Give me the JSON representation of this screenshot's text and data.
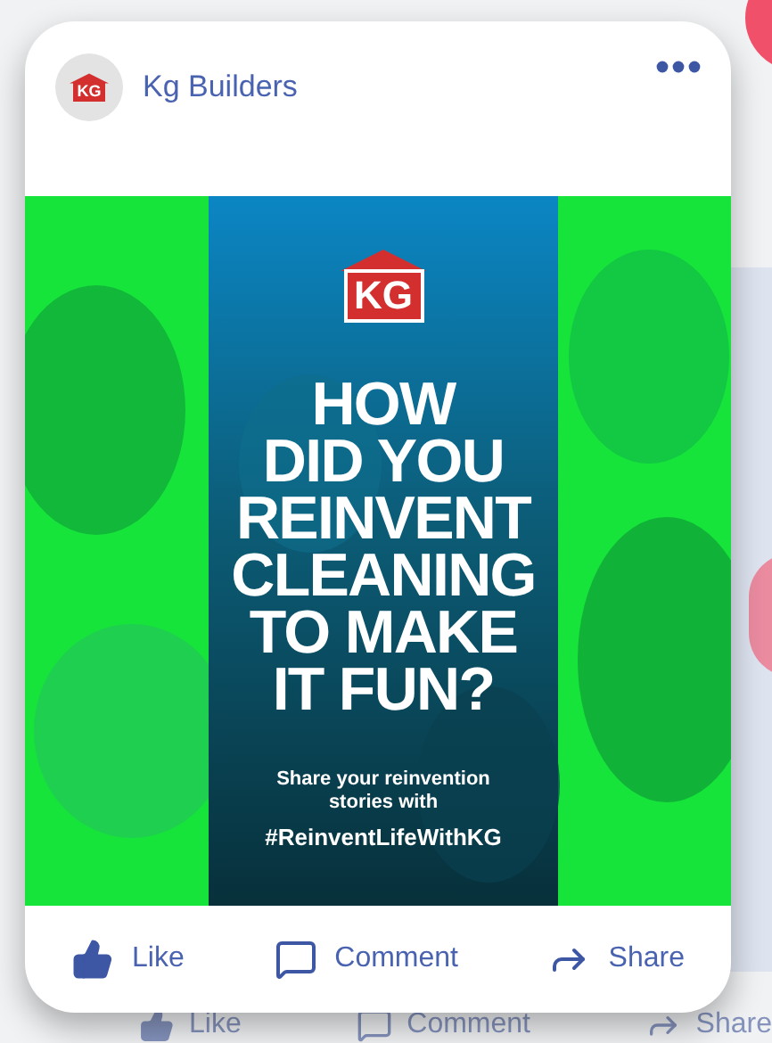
{
  "post": {
    "author": "Kg Builders",
    "avatar_logo": "KG",
    "image": {
      "logo": "KG",
      "headline": "HOW\nDID YOU\nREINVENT\nCLEANING\nTO MAKE\nIT FUN?",
      "caption": "Share your reinvention\nstories with",
      "hashtag": "#ReinventLifeWithKG"
    },
    "actions": [
      {
        "kind": "like",
        "label": "Like"
      },
      {
        "kind": "comment",
        "label": "Comment"
      },
      {
        "kind": "share",
        "label": "Share"
      }
    ]
  },
  "background_card": {
    "actions": [
      {
        "kind": "like",
        "label": "Like"
      },
      {
        "kind": "comment",
        "label": "Comment"
      },
      {
        "kind": "share",
        "label": "Share"
      }
    ]
  }
}
